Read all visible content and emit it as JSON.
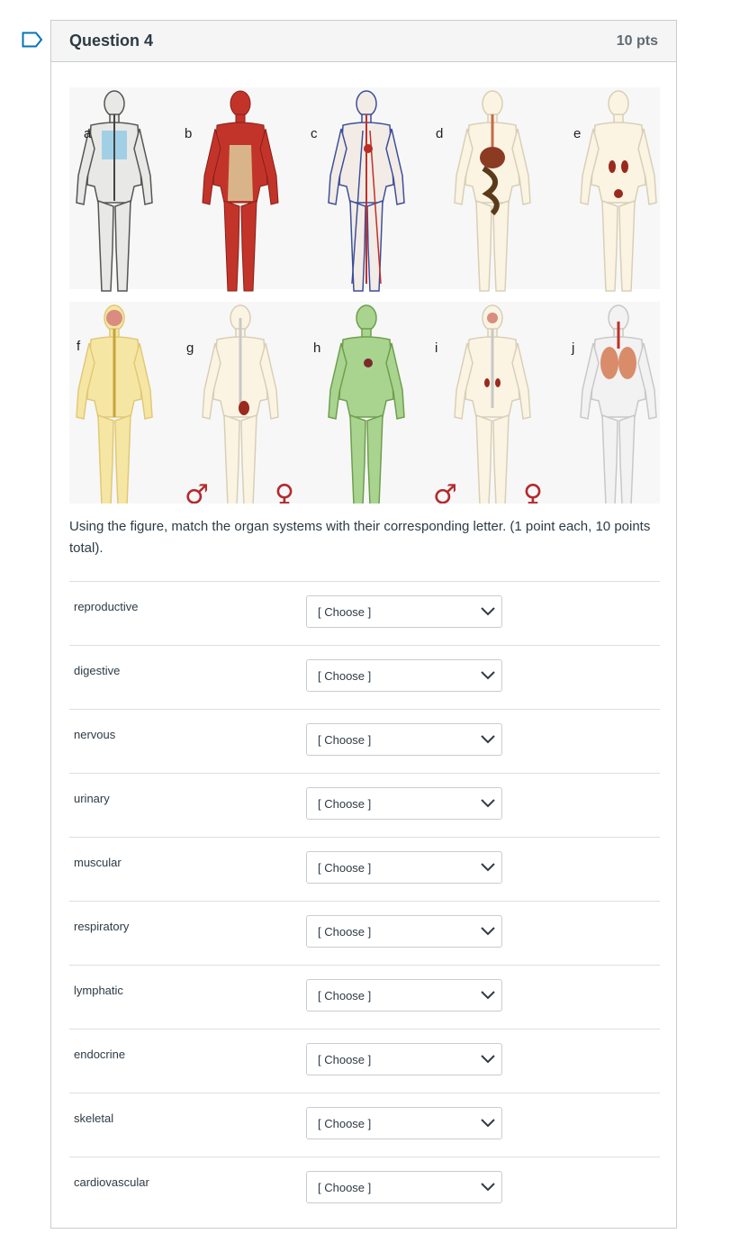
{
  "question": {
    "title": "Question 4",
    "points": "10 pts",
    "prompt": "Using the figure, match the organ systems with their corresponding letter. (1 point each, 10 points total)."
  },
  "figure": {
    "letters": [
      "a",
      "b",
      "c",
      "d",
      "e",
      "f",
      "g",
      "h",
      "i",
      "j"
    ],
    "male_symbol": "♂",
    "female_symbol": "♀"
  },
  "matches": [
    {
      "label": "reproductive",
      "value": "[ Choose ]"
    },
    {
      "label": "digestive",
      "value": "[ Choose ]"
    },
    {
      "label": "nervous",
      "value": "[ Choose ]"
    },
    {
      "label": "urinary",
      "value": "[ Choose ]"
    },
    {
      "label": "muscular",
      "value": "[ Choose ]"
    },
    {
      "label": "respiratory",
      "value": "[ Choose ]"
    },
    {
      "label": "lymphatic",
      "value": "[ Choose ]"
    },
    {
      "label": "endocrine",
      "value": "[ Choose ]"
    },
    {
      "label": "skeletal",
      "value": "[ Choose ]"
    },
    {
      "label": "cardiovascular",
      "value": "[ Choose ]"
    }
  ],
  "colors": {
    "flag": "#0374b5",
    "border": "#c7cdd1",
    "header_bg": "#f5f5f5",
    "text": "#2d3b45",
    "symbol": "#b32a2e"
  }
}
